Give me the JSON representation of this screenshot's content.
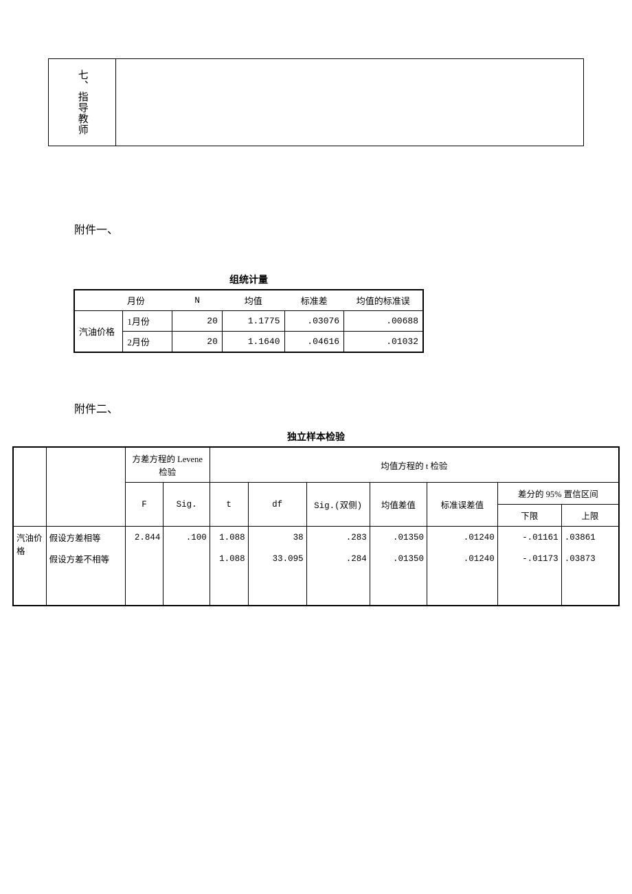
{
  "top_box": {
    "section_label": "七、指导教师"
  },
  "attachment1": {
    "heading": "附件一、",
    "table_title": "组统计量",
    "headers": {
      "col0": "",
      "col1": "月份",
      "col2": "N",
      "col3": "均值",
      "col4": "标准差",
      "col5": "均值的标准误"
    },
    "row_label": "汽油价格",
    "rows": [
      {
        "month": "1月份",
        "n": "20",
        "mean": "1.1775",
        "sd": ".03076",
        "sem": ".00688"
      },
      {
        "month": "2月份",
        "n": "20",
        "mean": "1.1640",
        "sd": ".04616",
        "sem": ".01032"
      }
    ]
  },
  "attachment2": {
    "heading": "附件二、",
    "table_title": "独立样本检验",
    "group_headers": {
      "levene": "方差方程的 Levene 检验",
      "ttest": "均值方程的 t 检验",
      "ci": "差分的 95% 置信区间"
    },
    "col_headers": {
      "F": "F",
      "Sig": "Sig.",
      "t": "t",
      "df": "df",
      "sig2": "Sig.(双侧)",
      "meandiff": "均值差值",
      "sediff": "标准误差值",
      "lower": "下限",
      "upper": "上限"
    },
    "row_label": "汽油价格",
    "rows": [
      {
        "assumption": "假设方差相等",
        "F": "2.844",
        "Sig": ".100",
        "t": "1.088",
        "df": "38",
        "sig2": ".283",
        "meandiff": ".01350",
        "sediff": ".01240",
        "lower": "-.01161",
        "upper": ".03861"
      },
      {
        "assumption": "假设方差不相等",
        "F": "",
        "Sig": "",
        "t": "1.088",
        "df": "33.095",
        "sig2": ".284",
        "meandiff": ".01350",
        "sediff": ".01240",
        "lower": "-.01173",
        "upper": ".03873"
      }
    ]
  }
}
